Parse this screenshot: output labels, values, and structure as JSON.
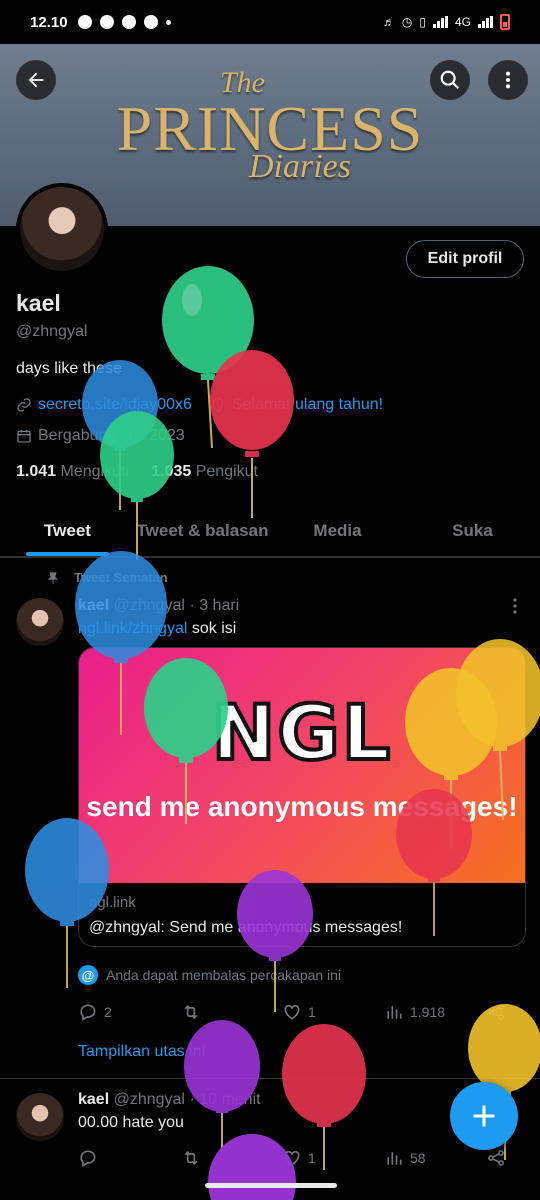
{
  "status_bar": {
    "time": "12.10",
    "network": "4G"
  },
  "banner": {
    "line_the": "The",
    "line_princess": "PRINCESS",
    "line_diaries": "Diaries"
  },
  "profile": {
    "edit_label": "Edit profil",
    "name": "kael",
    "handle": "@zhngyal",
    "bio": "days like these",
    "link": "secreto.site/idjay00x6",
    "birthday": "Selamat ulang tahun!",
    "joined": "Bergabung Juli 2023",
    "following_count": "1.041",
    "following_label": "Mengikuti",
    "followers_count": "1.035",
    "followers_label": "Pengikut"
  },
  "tabs": [
    {
      "label": "Tweet"
    },
    {
      "label": "Tweet & balasan"
    },
    {
      "label": "Media"
    },
    {
      "label": "Suka"
    }
  ],
  "pinned_label": "Tweet Sematan",
  "tweet1": {
    "name": "kael",
    "handle": "@zhngyal",
    "time": "· 3 hari",
    "link": "ngl.link/zhngyal",
    "text": "sok isi",
    "card": {
      "logo": "NGL",
      "tagline": "send me anonymous messages!",
      "domain": "ngl.link",
      "title": "@zhngyal: Send me anonymous messages!"
    },
    "reply_note": "Anda dapat membalas percakapan ini",
    "replies": "2",
    "retweets": "",
    "likes": "1",
    "views": "1.918",
    "thread_link": "Tampilkan utas ini"
  },
  "tweet2": {
    "name": "kael",
    "handle": "@zhngyal",
    "time": "· 10 menit",
    "text": "00.00 hate you",
    "replies": "",
    "retweets": "",
    "likes": "1",
    "views": "58"
  },
  "colors": {
    "accent": "#1d9bf0",
    "background": "#000000",
    "muted": "#71767b"
  },
  "icons": [
    "back-arrow-icon",
    "search-icon",
    "more-vertical-icon",
    "link-icon",
    "location-icon",
    "calendar-icon",
    "pin-icon",
    "reply-icon",
    "retweet-icon",
    "like-icon",
    "views-icon",
    "share-icon",
    "compose-plus-icon"
  ]
}
